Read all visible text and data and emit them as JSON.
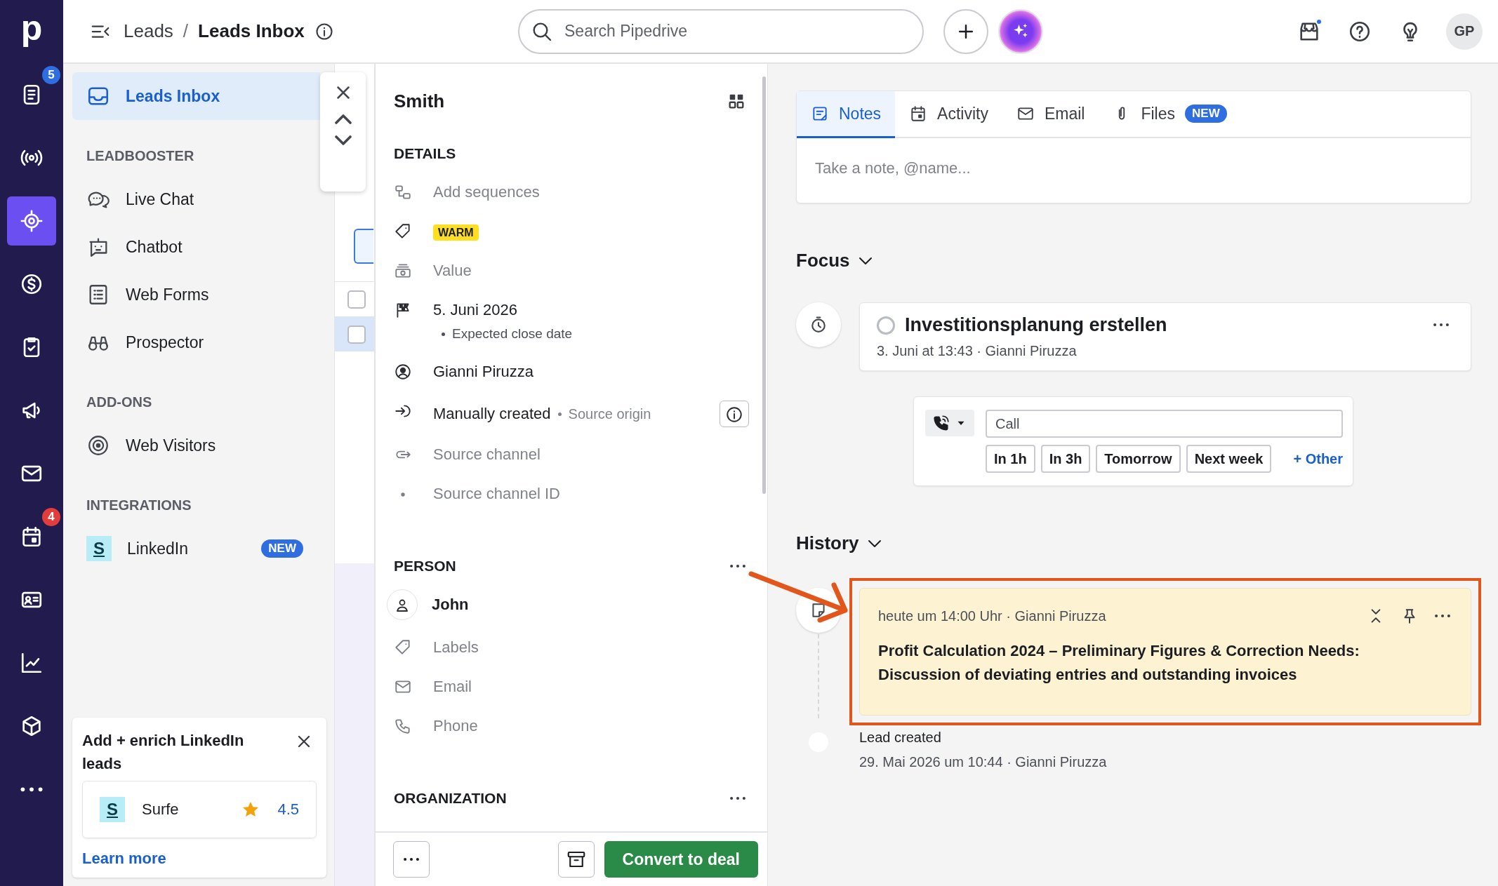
{
  "nav": {
    "logo": "p",
    "items": [
      {
        "selected": false,
        "badge": {
          "text": "5",
          "color": "#2e6ee0"
        }
      },
      {
        "selected": false
      },
      {
        "selected": true
      },
      {
        "selected": false
      },
      {
        "selected": false
      },
      {
        "selected": false
      },
      {
        "selected": false
      },
      {
        "selected": false,
        "badge": {
          "text": "4",
          "color": "#e23d3d"
        }
      },
      {
        "selected": false
      },
      {
        "selected": false
      },
      {
        "selected": false
      },
      {
        "selected": false
      }
    ]
  },
  "topbar": {
    "breadcrumb": {
      "parent": "Leads",
      "separator": "/",
      "current": "Leads Inbox"
    },
    "search": {
      "placeholder": "Search Pipedrive"
    },
    "avatar": "GP"
  },
  "sidebar": {
    "top_item": {
      "label": "Leads Inbox",
      "selected": true
    },
    "sections": [
      {
        "title": "LEADBOOSTER",
        "items": [
          {
            "label": "Live Chat",
            "selected": false
          },
          {
            "label": "Chatbot",
            "selected": false
          },
          {
            "label": "Web Forms",
            "selected": false
          },
          {
            "label": "Prospector",
            "selected": false
          }
        ]
      },
      {
        "title": "ADD-ONS",
        "items": [
          {
            "label": "Web Visitors",
            "selected": false
          }
        ]
      },
      {
        "title": "INTEGRATIONS",
        "items": [
          {
            "label": "LinkedIn",
            "selected": false,
            "logo": "S",
            "badge": "NEW"
          }
        ]
      }
    ],
    "promo": {
      "title": "Add + enrich LinkedIn leads",
      "app": {
        "logo": "S",
        "name": "Surfe",
        "rating": "4.5"
      },
      "link": "Learn more"
    }
  },
  "list_rows": [
    {
      "checked": false,
      "selected": false
    },
    {
      "checked": false,
      "selected": true
    }
  ],
  "detail": {
    "title": "Smith",
    "sections": [
      {
        "title": "DETAILS",
        "rows": [
          {
            "kind": "empty",
            "text": "Add sequences"
          },
          {
            "kind": "tag",
            "text": "WARM"
          },
          {
            "kind": "empty",
            "text": "Value"
          },
          {
            "kind": "value",
            "text": "5. Juni 2026",
            "note": "Expected close date"
          },
          {
            "kind": "value",
            "text": "Gianni Piruzza"
          },
          {
            "kind": "source",
            "text": "Manually created",
            "note": "Source origin"
          },
          {
            "kind": "empty",
            "text": "Source channel"
          },
          {
            "kind": "empty",
            "text": "Source channel ID"
          }
        ]
      },
      {
        "title": "PERSON",
        "menu": true,
        "rows": [
          {
            "kind": "name",
            "text": "John"
          },
          {
            "kind": "empty",
            "text": "Labels"
          },
          {
            "kind": "empty",
            "text": "Email"
          },
          {
            "kind": "empty",
            "text": "Phone"
          }
        ]
      },
      {
        "title": "ORGANIZATION",
        "menu": true
      }
    ],
    "footer": {
      "convert": "Convert to deal"
    }
  },
  "main": {
    "tabs": [
      {
        "label": "Notes",
        "selected": true
      },
      {
        "label": "Activity",
        "selected": false
      },
      {
        "label": "Email",
        "selected": false
      },
      {
        "label": "Files",
        "selected": false,
        "badge": "NEW"
      }
    ],
    "note_placeholder": "Take a note, @name...",
    "focus": {
      "title": "Focus",
      "expanded": true,
      "activity": {
        "title": "Investitionsplanung erstellen",
        "done": false,
        "meta": "3. Juni at 13:43 · Gianni Piruzza"
      },
      "quick": {
        "subject_placeholder": "Call",
        "options": [
          "In 1h",
          "In 3h",
          "Tomorrow",
          "Next week"
        ],
        "other": "+ Other"
      }
    },
    "history": {
      "title": "History",
      "expanded": true,
      "items": [
        {
          "kind": "note",
          "highlighted": true,
          "meta": "heute um 14:00 Uhr · Gianni Piruzza",
          "text": "Profit Calculation 2024 – Preliminary Figures & Correction Needs:\nDiscussion of deviating entries and outstanding invoices"
        },
        {
          "kind": "event",
          "title": "Lead created",
          "meta": "29. Mai 2026 um 10:44 · Gianni Piruzza"
        }
      ]
    }
  }
}
